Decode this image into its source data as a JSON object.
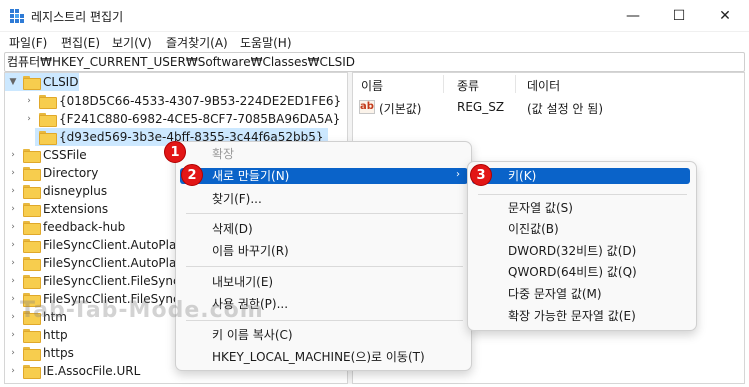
{
  "window": {
    "title": "레지스트리 편집기",
    "controls": {
      "minimize": "—",
      "maximize": "☐",
      "close": "✕"
    }
  },
  "menubar": {
    "items": [
      "파일(F)",
      "편집(E)",
      "보기(V)",
      "즐겨찾기(A)",
      "도움말(H)"
    ]
  },
  "address": {
    "path": "컴퓨터₩HKEY_CURRENT_USER₩Software₩Classes₩CLSID"
  },
  "tree": {
    "items": [
      {
        "label": "CLSID",
        "state": "expanded"
      },
      {
        "label": "{018D5C66-4533-4307-9B53-224DE2ED1FE6}",
        "state": "collapsed"
      },
      {
        "label": "{F241C880-6982-4CE5-8CF7-7085BA96DA5A}",
        "state": "collapsed"
      },
      {
        "label": "{d93ed569-3b3e-4bff-8355-3c44f6a52bb5}",
        "state": "selected"
      },
      {
        "label": "CSSFile",
        "state": "collapsed"
      },
      {
        "label": "Directory",
        "state": "collapsed"
      },
      {
        "label": "disneyplus",
        "state": "collapsed"
      },
      {
        "label": "Extensions",
        "state": "collapsed"
      },
      {
        "label": "feedback-hub",
        "state": "collapsed"
      },
      {
        "label": "FileSyncClient.AutoPlayH",
        "state": "collapsed"
      },
      {
        "label": "FileSyncClient.AutoPlayH",
        "state": "collapsed"
      },
      {
        "label": "FileSyncClient.FileSyncCl",
        "state": "collapsed"
      },
      {
        "label": "FileSyncClient.FileSyncCl",
        "state": "collapsed"
      },
      {
        "label": "htm",
        "state": "collapsed"
      },
      {
        "label": "http",
        "state": "collapsed"
      },
      {
        "label": "https",
        "state": "collapsed"
      },
      {
        "label": "IE.AssocFile.URL",
        "state": "collapsed"
      }
    ]
  },
  "values_list": {
    "headers": {
      "name": "이름",
      "type": "종류",
      "data": "데이터"
    },
    "rows": [
      {
        "icon": "ab",
        "name": "(기본값)",
        "type": "REG_SZ",
        "data": "(값 설정 안 됨)"
      }
    ]
  },
  "context_menu": {
    "items": {
      "expand": "확장",
      "new": "새로 만들기(N)",
      "find": "찾기(F)...",
      "delete": "삭제(D)",
      "rename": "이름 바꾸기(R)",
      "export": "내보내기(E)",
      "permissions": "사용 권한(P)...",
      "copy_key_name": "키 이름 복사(C)",
      "goto_hklm": "HKEY_LOCAL_MACHINE(으)로 이동(T)"
    },
    "submenu_arrow": "›"
  },
  "submenu": {
    "items": {
      "key": "키(K)",
      "string": "문자열 값(S)",
      "binary": "이진값(B)",
      "dword": "DWORD(32비트) 값(D)",
      "qword": "QWORD(64비트) 값(Q)",
      "multi_string": "다중 문자열 값(M)",
      "expandable_string": "확장 가능한 문자열 값(E)"
    }
  },
  "badges": {
    "b1": "1",
    "b2": "2",
    "b3": "3"
  },
  "watermark": "Tab-Tab-Mode.com",
  "colors": {
    "highlight": "#0a63c9",
    "selected_row": "#cce8ff",
    "badge": "#e21616",
    "folder": "#f7cd4e"
  }
}
